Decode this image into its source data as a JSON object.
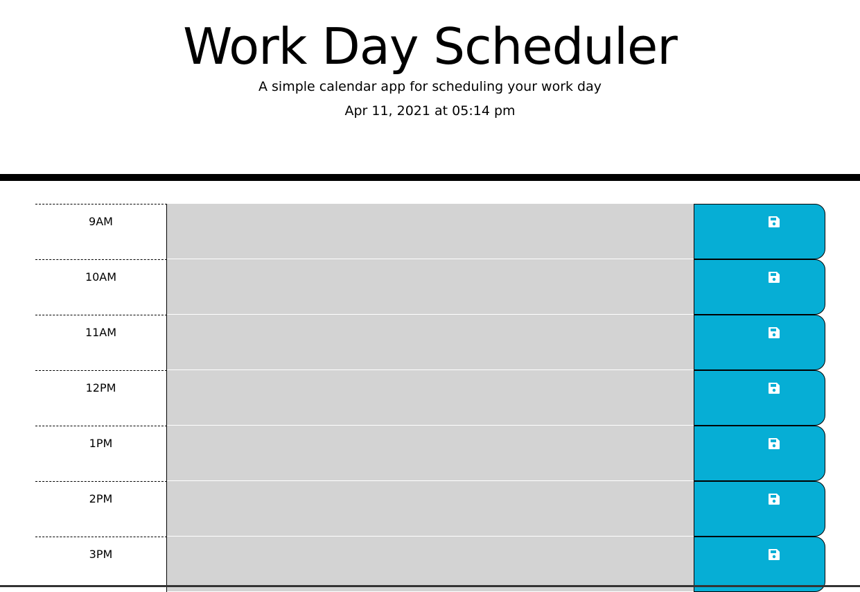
{
  "header": {
    "title": "Work Day Scheduler",
    "lead": "A simple calendar app for scheduling your work day",
    "current_day": "Apr 11, 2021 at 05:14 pm"
  },
  "colors": {
    "past": "#d3d3d3",
    "save_button": "#06aed5"
  },
  "time_blocks": [
    {
      "hour": "9AM",
      "text": "",
      "icon": "floppy-disk-icon"
    },
    {
      "hour": "10AM",
      "text": "",
      "icon": "floppy-disk-icon"
    },
    {
      "hour": "11AM",
      "text": "",
      "icon": "floppy-disk-icon"
    },
    {
      "hour": "12PM",
      "text": "",
      "icon": "floppy-disk-icon"
    },
    {
      "hour": "1PM",
      "text": "",
      "icon": "floppy-disk-icon"
    },
    {
      "hour": "2PM",
      "text": "",
      "icon": "floppy-disk-icon"
    },
    {
      "hour": "3PM",
      "text": "",
      "icon": "floppy-disk-icon"
    }
  ]
}
